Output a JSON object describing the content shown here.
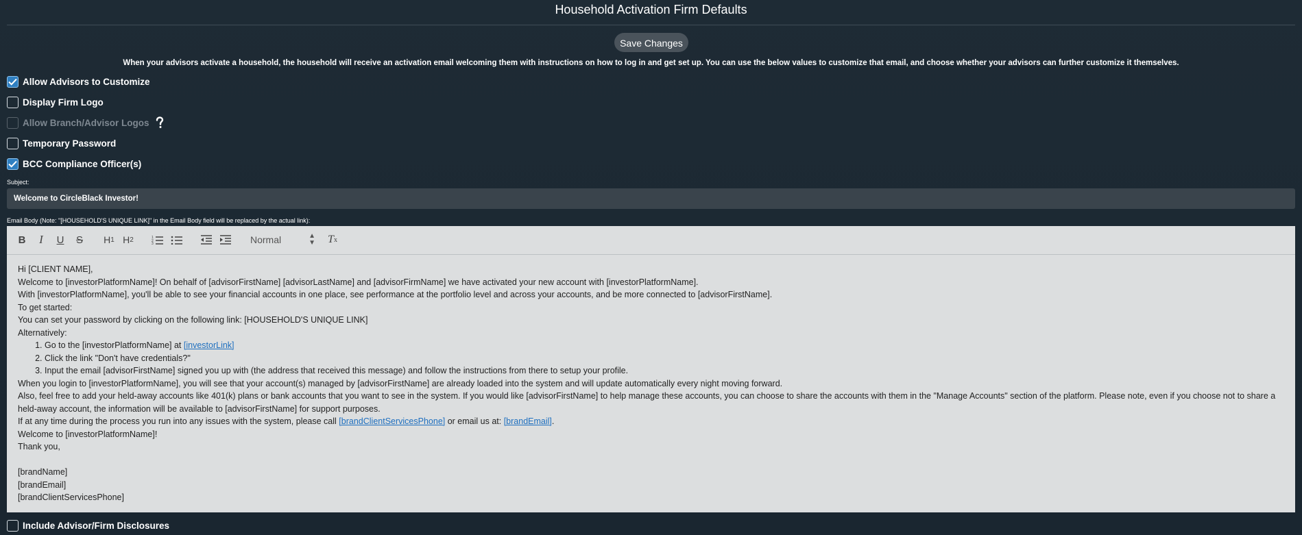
{
  "header": {
    "title": "Household Activation Firm Defaults",
    "save_label": "Save Changes",
    "intro": "When your advisors activate a household, the household will receive an activation email welcoming them with instructions on how to log in and get set up. You can use the below values to customize that email, and choose whether your advisors can further customize it themselves."
  },
  "options": {
    "allow_customize": {
      "label": "Allow Advisors to Customize",
      "checked": true
    },
    "display_logo": {
      "label": "Display Firm Logo",
      "checked": false
    },
    "allow_branch_logos": {
      "label": "Allow Branch/Advisor Logos",
      "checked": false,
      "disabled": true
    },
    "temp_password": {
      "label": "Temporary Password",
      "checked": false
    },
    "bcc_compliance": {
      "label": "BCC Compliance Officer(s)",
      "checked": true
    },
    "include_disclosures": {
      "label": "Include Advisor/Firm Disclosures",
      "checked": false
    }
  },
  "subject": {
    "label": "Subject:",
    "value": "Welcome to CircleBlack Investor!"
  },
  "email_body": {
    "label": "Email Body (Note: \"[HOUSEHOLD'S UNIQUE LINK]\" in the Email Body field will be replaced by the actual link):",
    "format_value": "Normal",
    "lines": {
      "l1": "Hi [CLIENT NAME],",
      "l2": "Welcome to [investorPlatformName]! On behalf of [advisorFirstName] [advisorLastName] and [advisorFirmName] we have activated your new account with [investorPlatformName].",
      "l3": "With [investorPlatformName], you'll be able to see your financial accounts in one place, see performance at the portfolio level and across your accounts, and be more connected to [advisorFirstName].",
      "l4": "To get started:",
      "l5": "You can set your password by clicking on the following link: [HOUSEHOLD'S UNIQUE LINK]",
      "l6": "Alternatively:",
      "step1_text": "Go to the [investorPlatformName] at ",
      "step1_link": "[investorLink]",
      "step2": "Click the link \"Don't have credentials?\"",
      "step3": "Input the email [advisorFirstName] signed you up with (the address that received this message) and follow the instructions from there to setup your profile.",
      "l7": "When you login to [investorPlatformName], you will see that your account(s) managed by [advisorFirstName] are already loaded into the system and will update automatically every night moving forward.",
      "l8": "Also, feel free to add your held-away accounts like 401(k) plans or bank accounts that you want to see in the system. If you would like [advisorFirstName] to help manage these accounts, you can choose to share the accounts with them in the \"Manage Accounts\" section of the platform. Please note, even if you choose not to share a held-away account, the information will be available to [advisorFirstName] for support purposes.",
      "l9_a": "If at any time during the process you run into any issues with the system, please call ",
      "l9_link1": "[brandClientServicesPhone]",
      "l9_b": " or email us at: ",
      "l9_link2": "[brandEmail]",
      "l9_c": ".",
      "l10": "Welcome to [investorPlatformName]!",
      "l11": "Thank you,",
      "sig1": "[brandName]",
      "sig2": "[brandEmail]",
      "sig3": "[brandClientServicesPhone]"
    }
  },
  "colors": {
    "background": "#1e2b35",
    "checkbox_checked": "#2f7fc1",
    "link": "#1e6fbf",
    "editor_bg": "#dcdedf"
  }
}
